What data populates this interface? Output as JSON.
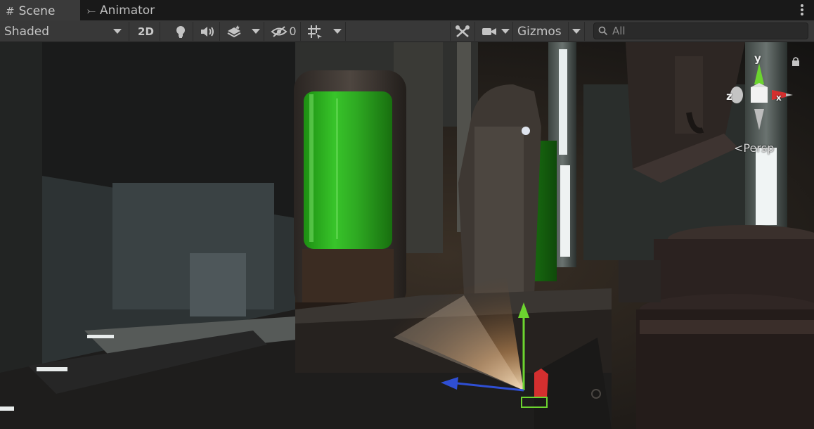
{
  "tabs": [
    {
      "label": "Scene",
      "icon": "grid-icon",
      "active": true
    },
    {
      "label": "Animator",
      "icon": "animator-icon",
      "active": false
    }
  ],
  "toolbar": {
    "shading_mode": "Shaded",
    "mode_2d_label": "2D",
    "hidden_count": "0",
    "gizmos_label": "Gizmos",
    "search_placeholder": "All"
  },
  "view": {
    "projection_label": "Persp",
    "axis_y": "y",
    "axis_z": "z",
    "axis_x": "x"
  },
  "colors": {
    "axis_x": "#d42f2f",
    "axis_y": "#6cd42f",
    "axis_z": "#2f4fd4",
    "toolbar_bg": "#383838",
    "tab_active_bg": "#3a3a3a"
  }
}
